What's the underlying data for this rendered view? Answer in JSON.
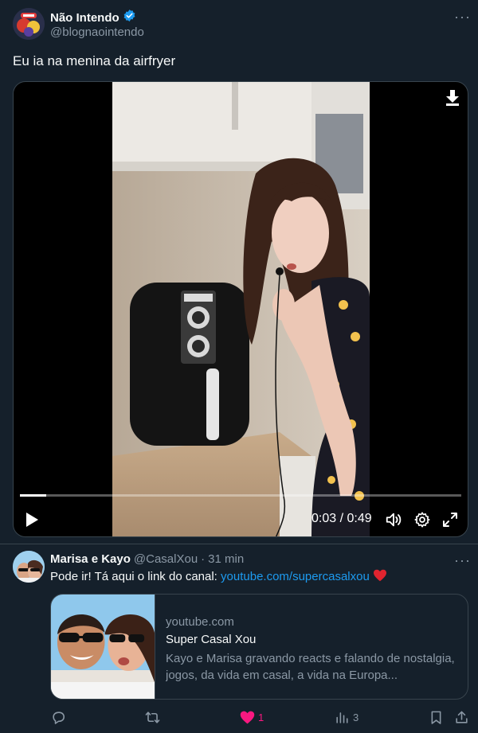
{
  "post": {
    "author_name": "Não Intendo",
    "verified": true,
    "handle": "@blognaointendo",
    "text": "Eu ia na menina da airfryer",
    "video": {
      "timecode": "0:03 / 0:49",
      "progress": 0.06
    }
  },
  "reply": {
    "author_name": "Marisa e Kayo",
    "handle": "@CasalXou",
    "separator": "·",
    "time": "31 min",
    "text_prefix": "Pode ir! Tá aqui o link do canal: ",
    "link_text": "youtube.com/supercasalxou",
    "card": {
      "domain": "youtube.com",
      "title": "Super Casal Xou",
      "description": "Kayo e Marisa gravando reacts e falando de nostalgia, jogos, da vida em casal, a vida na Europa..."
    },
    "actions": {
      "likes": "1",
      "views": "3"
    }
  },
  "colors": {
    "background": "#15202b",
    "accent": "#1d9bf0",
    "like": "#f91880",
    "muted": "#8b98a5"
  }
}
